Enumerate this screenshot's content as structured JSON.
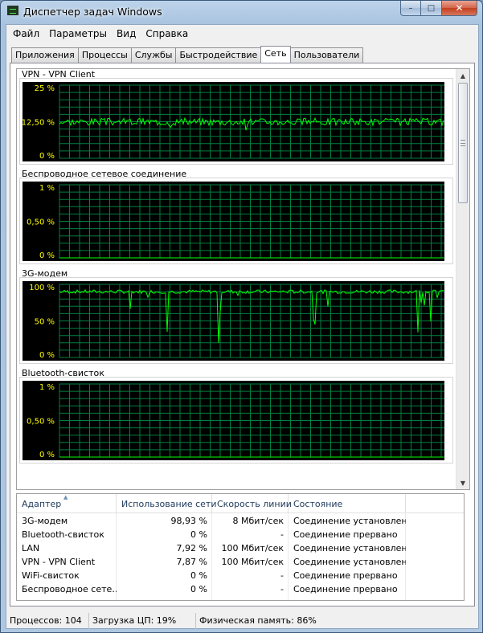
{
  "window": {
    "title": "Диспетчер задач Windows"
  },
  "caption": {
    "minimize": "–",
    "maximize": "□",
    "close": "✕"
  },
  "menu": [
    "Файл",
    "Параметры",
    "Вид",
    "Справка"
  ],
  "tabs": [
    "Приложения",
    "Процессы",
    "Службы",
    "Быстродействие",
    "Сеть",
    "Пользователи"
  ],
  "active_tab": "Сеть",
  "colors": {
    "graph_bg": "#000000",
    "grid": "#008040",
    "trace": "#00ff00",
    "scale_text": "#ffff00"
  },
  "graphs": [
    {
      "title": "VPN - VPN Client",
      "scale": [
        "25 %",
        "12,50 %",
        "0 %"
      ],
      "baseline_fraction": 0.5,
      "variation": 0.1,
      "dips": 0.15,
      "seed": 3
    },
    {
      "title": "Беспроводное сетевое соединение",
      "scale": [
        "1 %",
        "0,50 %",
        "0 %"
      ],
      "baseline_fraction": 0,
      "variation": 0,
      "dips": 0,
      "seed": 5
    },
    {
      "title": "3G-модем",
      "scale": [
        "100 %",
        "50 %",
        "0 %"
      ],
      "baseline_fraction": 0.9,
      "variation": 0.05,
      "dips": 0.5,
      "seed": 7
    },
    {
      "title": "Bluetooth-свисток",
      "scale": [
        "1 %",
        "0,50 %",
        "0 %"
      ],
      "baseline_fraction": 0,
      "variation": 0,
      "dips": 0,
      "seed": 11
    }
  ],
  "table": {
    "columns": [
      "Адаптер",
      "Использование сети",
      "Скорость линии",
      "Состояние"
    ],
    "rows": [
      [
        "3G-модем",
        "98,93 %",
        "8 Мбит/сек",
        "Соединение установлено"
      ],
      [
        "Bluetooth-свисток",
        "0 %",
        "-",
        "Соединение прервано"
      ],
      [
        "LAN",
        "7,92 %",
        "100 Мбит/сек",
        "Соединение установлено"
      ],
      [
        "VPN - VPN Client",
        "7,87 %",
        "100 Мбит/сек",
        "Соединение установлено"
      ],
      [
        "WiFi-свисток",
        "0 %",
        "-",
        "Соединение прервано"
      ],
      [
        "Беспроводное сете…",
        "0 %",
        "-",
        "Соединение прервано"
      ]
    ]
  },
  "status": {
    "processes": "Процессов: 104",
    "cpu": "Загрузка ЦП: 19%",
    "memory": "Физическая память: 86%"
  }
}
